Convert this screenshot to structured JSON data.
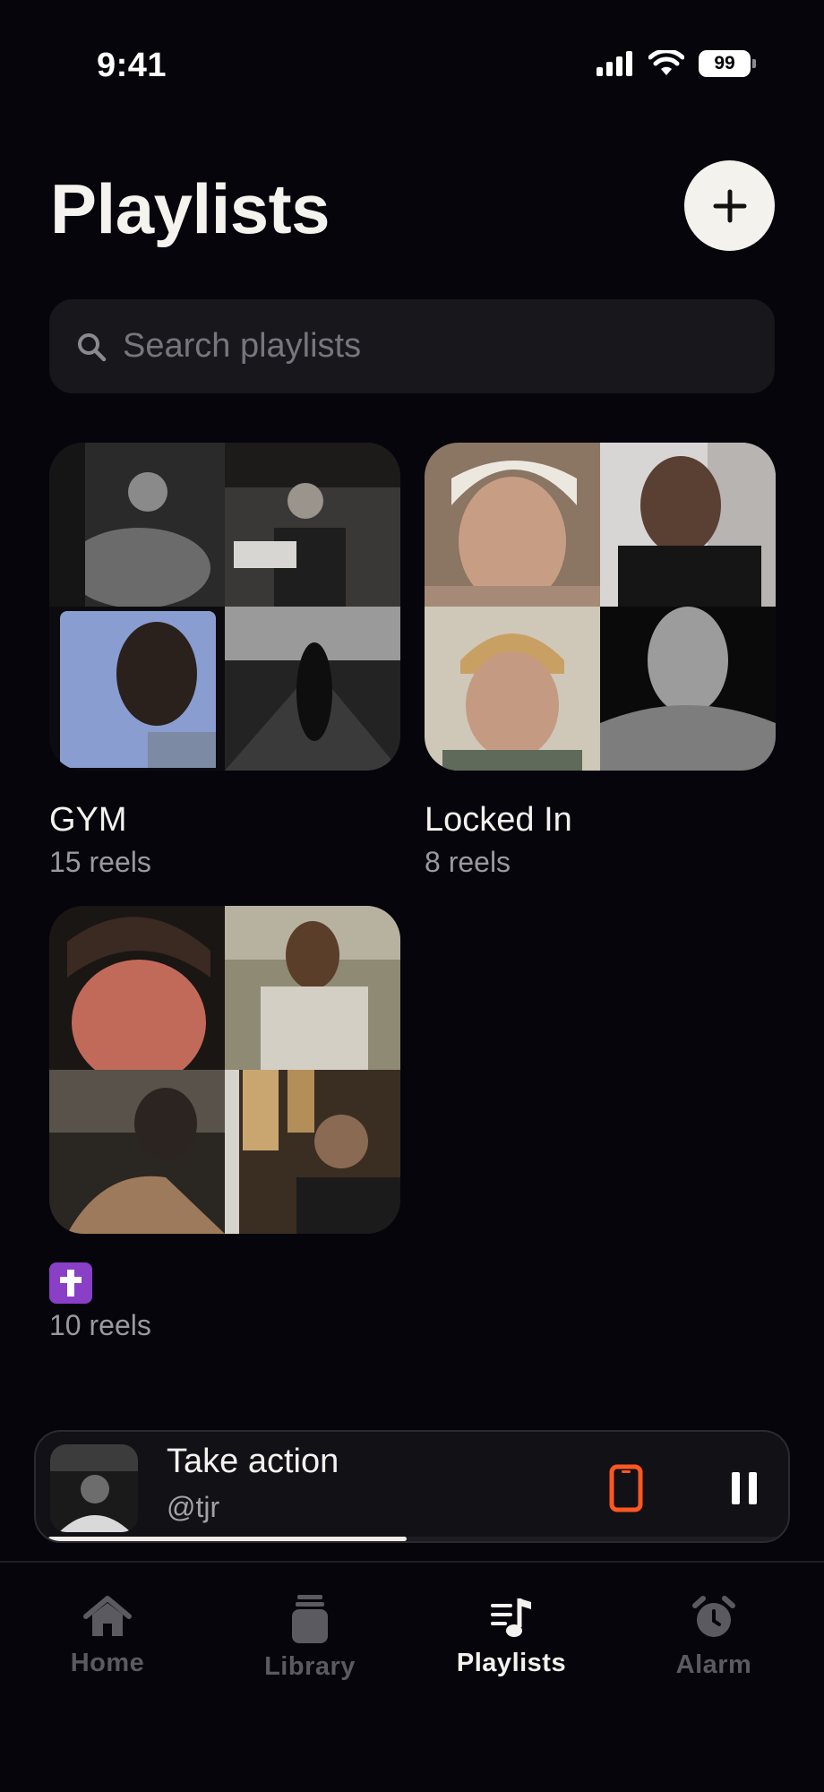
{
  "status_bar": {
    "time": "9:41",
    "battery": "99"
  },
  "header": {
    "title": "Playlists"
  },
  "search": {
    "placeholder": "Search playlists",
    "value": ""
  },
  "playlists": [
    {
      "title": "GYM",
      "count": "15 reels"
    },
    {
      "title": "Locked In",
      "count": "8 reels"
    },
    {
      "title": "✝️",
      "count": "10 reels"
    }
  ],
  "now_playing": {
    "title": "Take action",
    "artist": "@tjr",
    "progress": 0.49
  },
  "tabs": [
    {
      "label": "Home",
      "icon": "house-icon",
      "active": false
    },
    {
      "label": "Library",
      "icon": "cup-icon",
      "active": false
    },
    {
      "label": "Playlists",
      "icon": "music-list-icon",
      "active": true
    },
    {
      "label": "Alarm",
      "icon": "alarm-clock-icon",
      "active": false
    }
  ],
  "colors": {
    "accent": "#ff5722",
    "background": "#06050b",
    "surface": "#18171c",
    "emoji_badge": "#8a3fc7"
  }
}
